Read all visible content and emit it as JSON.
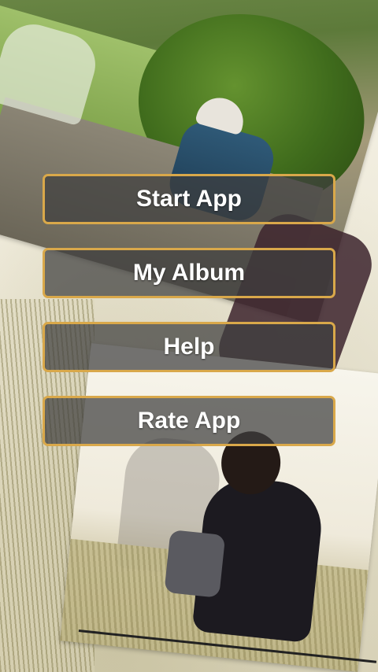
{
  "menu": {
    "buttons": [
      {
        "label": "Start App"
      },
      {
        "label": "My Album"
      },
      {
        "label": "Help"
      },
      {
        "label": "Rate App"
      }
    ]
  },
  "colors": {
    "button_border": "#d9a84a",
    "button_fill": "#3e3e3e",
    "button_text": "#ffffff"
  }
}
